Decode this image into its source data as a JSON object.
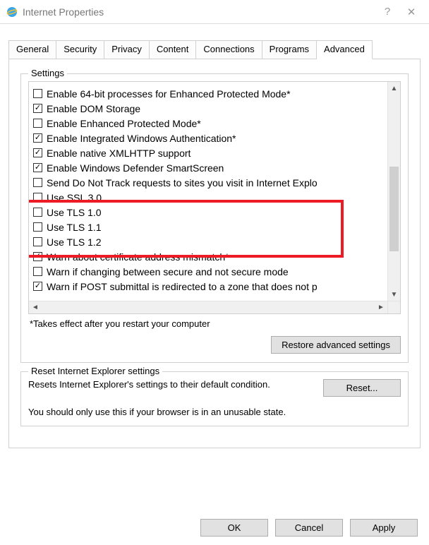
{
  "window": {
    "title": "Internet Properties",
    "help": "?",
    "close": "✕"
  },
  "tabs": [
    "General",
    "Security",
    "Privacy",
    "Content",
    "Connections",
    "Programs",
    "Advanced"
  ],
  "activeTab": 6,
  "settings": {
    "groupLabel": "Settings",
    "items": [
      {
        "checked": false,
        "label": "Enable 64-bit processes for Enhanced Protected Mode*"
      },
      {
        "checked": true,
        "label": "Enable DOM Storage"
      },
      {
        "checked": false,
        "label": "Enable Enhanced Protected Mode*"
      },
      {
        "checked": true,
        "label": "Enable Integrated Windows Authentication*"
      },
      {
        "checked": true,
        "label": "Enable native XMLHTTP support"
      },
      {
        "checked": true,
        "label": "Enable Windows Defender SmartScreen"
      },
      {
        "checked": false,
        "label": "Send Do Not Track requests to sites you visit in Internet Explo"
      },
      {
        "checked": false,
        "label": "Use SSL 3.0"
      },
      {
        "checked": false,
        "label": "Use TLS 1.0"
      },
      {
        "checked": false,
        "label": "Use TLS 1.1"
      },
      {
        "checked": false,
        "label": "Use TLS 1.2"
      },
      {
        "checked": true,
        "label": "Warn about certificate address mismatch*"
      },
      {
        "checked": false,
        "label": "Warn if changing between secure and not secure mode"
      },
      {
        "checked": true,
        "label": "Warn if POST submittal is redirected to a zone that does not p"
      }
    ],
    "note": "*Takes effect after you restart your computer",
    "restoreBtn": "Restore advanced settings"
  },
  "reset": {
    "groupLabel": "Reset Internet Explorer settings",
    "desc": "Resets Internet Explorer's settings to their default condition.",
    "btn": "Reset...",
    "warn": "You should only use this if your browser is in an unusable state."
  },
  "buttons": {
    "ok": "OK",
    "cancel": "Cancel",
    "apply": "Apply"
  },
  "highlight": {
    "covers": [
      "Use TLS 1.0",
      "Use TLS 1.1",
      "Use TLS 1.2"
    ]
  }
}
